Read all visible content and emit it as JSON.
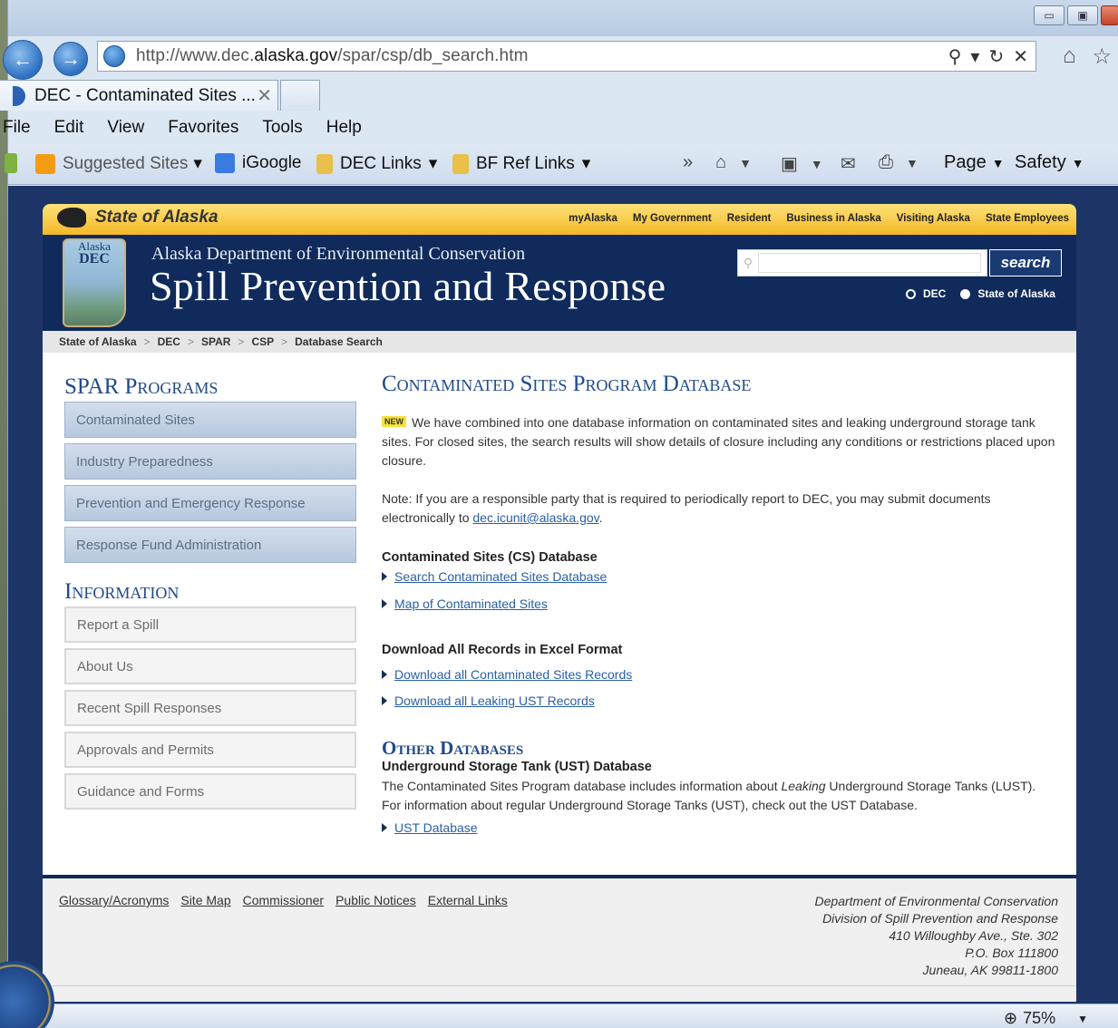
{
  "browser": {
    "url_prefix": "http://www.dec.",
    "url_domain": "alaska.gov",
    "url_path": "/spar/csp/db_search.htm",
    "tab_title": "DEC - Contaminated Sites ...",
    "menu": [
      "File",
      "Edit",
      "View",
      "Favorites",
      "Tools",
      "Help"
    ],
    "favorites": [
      "Suggested Sites",
      "iGoogle",
      "DEC Links",
      "BF Ref Links"
    ],
    "command_page": "Page",
    "command_safety": "Safety",
    "zoom": "75%"
  },
  "site": {
    "state_title": "State of Alaska",
    "top_links": [
      "myAlaska",
      "My Government",
      "Resident",
      "Business in Alaska",
      "Visiting Alaska",
      "State Employees"
    ],
    "logo_small": "Alaska",
    "logo_big": "DEC",
    "dept": "Alaska Department of Environmental Conservation",
    "division": "Spill Prevention and Response",
    "search_label": "search",
    "radio_dec": "DEC",
    "radio_state": "State of Alaska",
    "breadcrumb": [
      "State of Alaska",
      "DEC",
      "SPAR",
      "CSP",
      "Database Search"
    ]
  },
  "sidebar": {
    "programs_heading": "SPAR Programs",
    "programs": [
      "Contaminated Sites",
      "Industry Preparedness",
      "Prevention and Emergency Response",
      "Response Fund Administration"
    ],
    "info_heading": "Information",
    "info": [
      "Report a Spill",
      "About Us",
      "Recent Spill Responses",
      "Approvals and Permits",
      "Guidance and Forms"
    ]
  },
  "content": {
    "heading": "Contaminated Sites Program Database",
    "new_badge": "NEW",
    "intro": "We have combined into one database information on contaminated sites and leaking underground storage tank sites. For closed sites, the search results will show details of closure including any conditions or restrictions placed upon closure.",
    "note_label": "Note:",
    "note_text": " If you are a responsible party that is required to periodically report to DEC, you may submit documents electronically to ",
    "note_email": "dec.icunit@alaska.gov",
    "note_end": ".",
    "cs_heading": "Contaminated Sites (CS) Database",
    "cs_link1": "Search Contaminated Sites Database",
    "cs_link2": "Map of Contaminated Sites",
    "dl_heading": "Download All Records in Excel Format",
    "dl_link1": "Download all Contaminated Sites Records",
    "dl_link2": "Download all Leaking UST Records",
    "other_heading": "Other Databases",
    "ust_heading": "Underground Storage Tank (UST) Database",
    "ust_text1": "The Contaminated Sites Program database includes information about ",
    "ust_text_em": "Leaking",
    "ust_text2": " Underground Storage Tanks (LUST). For information about regular Underground Storage Tanks (UST), check out the UST Database.",
    "ust_link": "UST Database"
  },
  "footer": {
    "links": [
      "Glossary/Acronyms",
      "Site Map",
      "Commissioner",
      "Public Notices",
      "External Links"
    ],
    "address": [
      "Department of Environmental Conservation",
      "Division of Spill Prevention and Response",
      "410 Willoughby Ave., Ste. 302",
      "P.O. Box 111800",
      "Juneau, AK 99811-1800"
    ]
  }
}
